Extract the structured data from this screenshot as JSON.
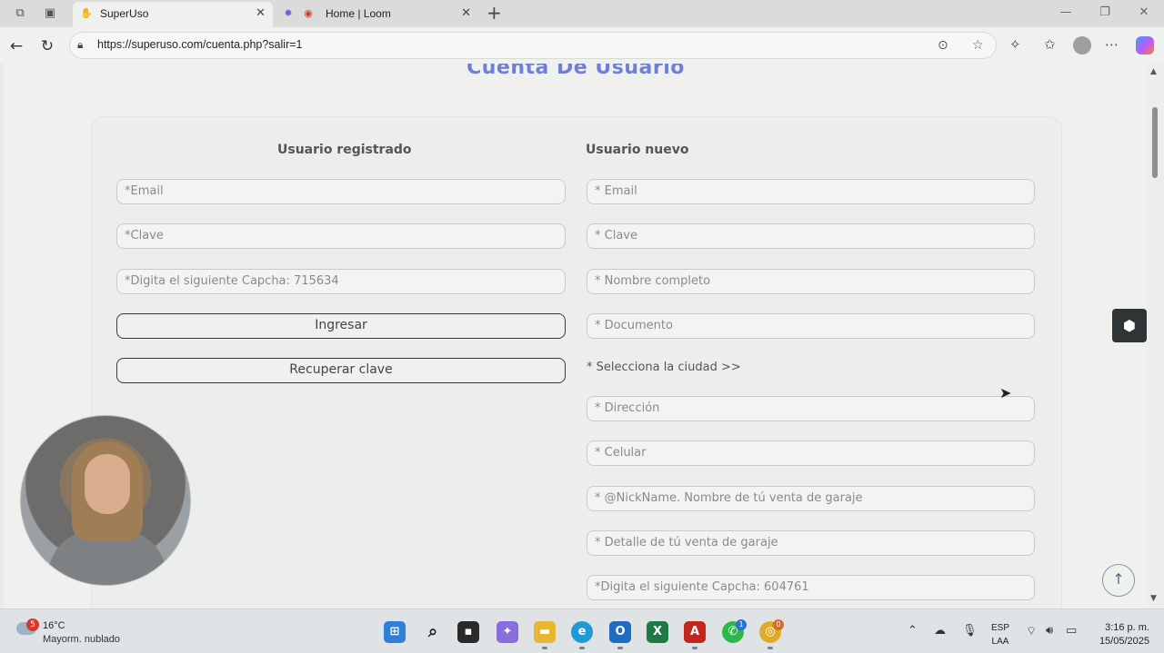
{
  "browser": {
    "tabs": [
      {
        "title": "SuperUso",
        "active": true
      },
      {
        "title": "Home | Loom",
        "active": false
      }
    ],
    "url": "https://superuso.com/cuenta.php?salir=1"
  },
  "page": {
    "heading": "Cuenta De Usuario",
    "login": {
      "title": "Usuario registrado",
      "email_placeholder": "*Email",
      "password_placeholder": "*Clave",
      "captcha_placeholder": "*Digita el siguiente Capcha: 715634",
      "submit_label": "Ingresar",
      "recover_label": "Recuperar clave"
    },
    "register": {
      "title": "Usuario nuevo",
      "email_placeholder": "* Email",
      "password_placeholder": "* Clave",
      "fullname_placeholder": "* Nombre completo",
      "document_placeholder": "* Documento",
      "city_hint": "* Selecciona la ciudad >>",
      "address_placeholder": "* Dirección",
      "phone_placeholder": "* Celular",
      "nickname_placeholder": "* @NickName. Nombre de tú venta de garaje",
      "detail_placeholder": "* Detalle de tú venta de garaje",
      "captcha_placeholder": "*Digita el siguiente Capcha: 604761"
    }
  },
  "taskbar": {
    "weather_badge": "5",
    "weather_temp": "16°C",
    "weather_desc": "Mayorm. nublado",
    "lang_top": "ESP",
    "lang_bottom": "LAA",
    "time": "3:16 p. m.",
    "date": "15/05/2025",
    "whatsapp_badge": "1",
    "chrome_badge": "0"
  },
  "colors": {
    "heading": "#6f7fd6",
    "page_bg": "#f0f1ee",
    "button_border": "#3a3a3a"
  }
}
